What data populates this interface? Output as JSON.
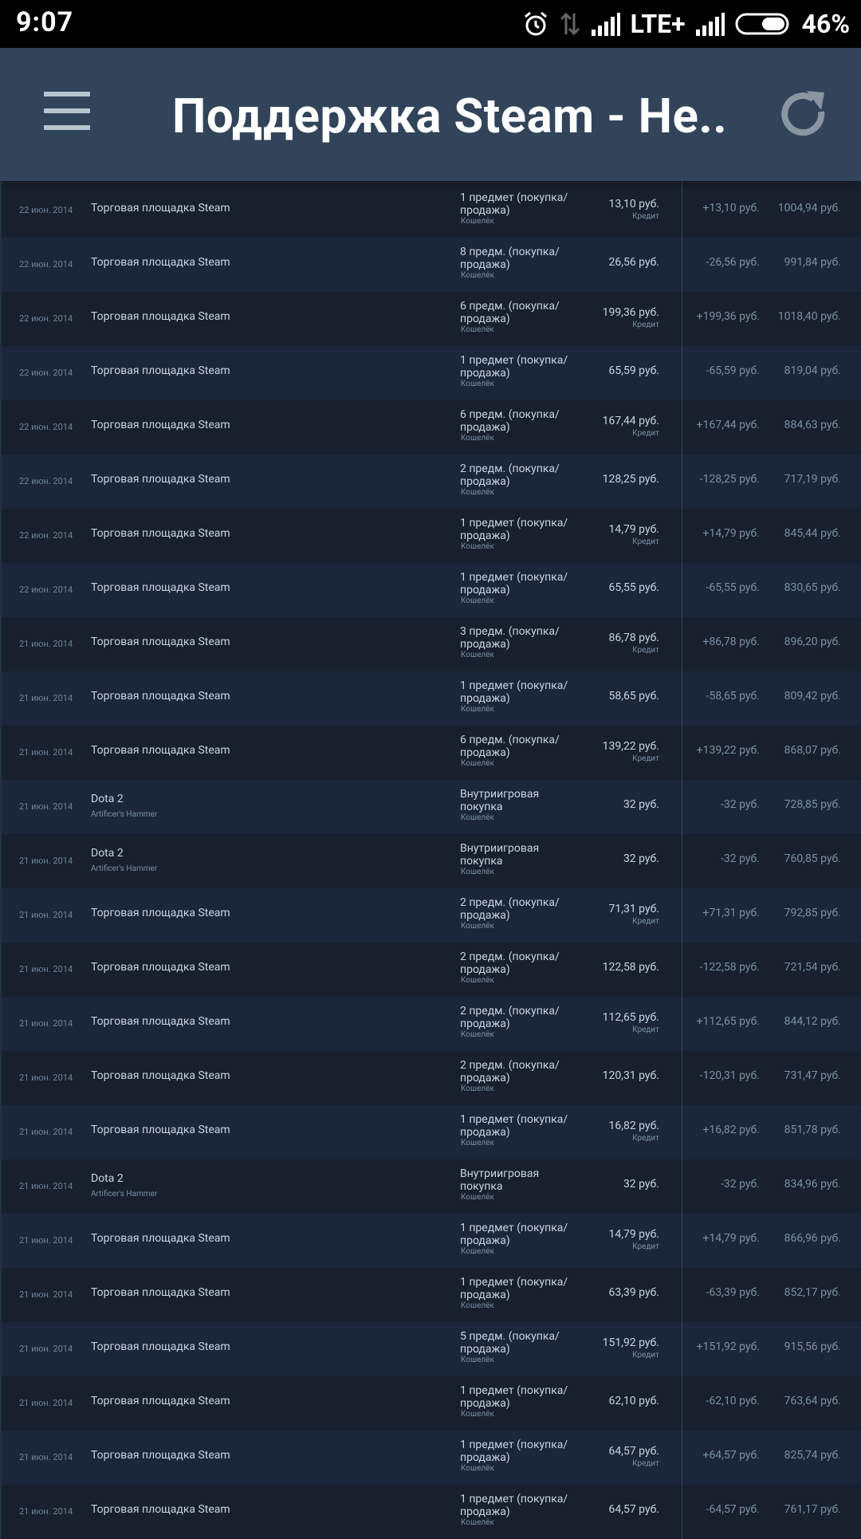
{
  "status_bar": {
    "time": "9:07",
    "network": "LTE+",
    "battery": "46%"
  },
  "app_bar": {
    "title": "Поддержка Steam - Не...",
    "menu_icon": "hamburger-menu-icon",
    "refresh_icon": "refresh-icon"
  },
  "colors": {
    "status_bg": "#000000",
    "app_bar_bg": "#32445a",
    "row_dark": "#17202c",
    "row_light": "#1b2738",
    "text_primary": "#c6d4df",
    "text_muted": "#7c8fa3"
  },
  "rows": [
    {
      "date": "",
      "name": "Торговая площадка Steam",
      "subtitle": "",
      "type": "1 предмет (покупка/ продажа)",
      "method": "Кошелёк",
      "amount": "",
      "credit": "",
      "change": "",
      "balance": ""
    },
    {
      "date": "22 июн. 2014",
      "name": "Торговая площадка Steam",
      "subtitle": "",
      "type": "1 предмет (покупка/ продажа)",
      "method": "Кошелёк",
      "amount": "13,10 руб.",
      "credit": "Кредит",
      "change": "+13,10 руб.",
      "balance": "1004,94 руб."
    },
    {
      "date": "22 июн. 2014",
      "name": "Торговая площадка Steam",
      "subtitle": "",
      "type": "8 предм. (покупка/ продажа)",
      "method": "Кошелёк",
      "amount": "26,56 руб.",
      "credit": "",
      "change": "-26,56 руб.",
      "balance": "991,84 руб."
    },
    {
      "date": "22 июн. 2014",
      "name": "Торговая площадка Steam",
      "subtitle": "",
      "type": "6 предм. (покупка/ продажа)",
      "method": "Кошелёк",
      "amount": "199,36 руб.",
      "credit": "Кредит",
      "change": "+199,36 руб.",
      "balance": "1018,40 руб."
    },
    {
      "date": "22 июн. 2014",
      "name": "Торговая площадка Steam",
      "subtitle": "",
      "type": "1 предмет (покупка/ продажа)",
      "method": "Кошелёк",
      "amount": "65,59 руб.",
      "credit": "",
      "change": "-65,59 руб.",
      "balance": "819,04 руб."
    },
    {
      "date": "22 июн. 2014",
      "name": "Торговая площадка Steam",
      "subtitle": "",
      "type": "6 предм. (покупка/ продажа)",
      "method": "Кошелёк",
      "amount": "167,44 руб.",
      "credit": "Кредит",
      "change": "+167,44 руб.",
      "balance": "884,63 руб."
    },
    {
      "date": "22 июн. 2014",
      "name": "Торговая площадка Steam",
      "subtitle": "",
      "type": "2 предм. (покупка/ продажа)",
      "method": "Кошелёк",
      "amount": "128,25 руб.",
      "credit": "",
      "change": "-128,25 руб.",
      "balance": "717,19 руб."
    },
    {
      "date": "22 июн. 2014",
      "name": "Торговая площадка Steam",
      "subtitle": "",
      "type": "1 предмет (покупка/ продажа)",
      "method": "Кошелёк",
      "amount": "14,79 руб.",
      "credit": "Кредит",
      "change": "+14,79 руб.",
      "balance": "845,44 руб."
    },
    {
      "date": "22 июн. 2014",
      "name": "Торговая площадка Steam",
      "subtitle": "",
      "type": "1 предмет (покупка/ продажа)",
      "method": "Кошелёк",
      "amount": "65,55 руб.",
      "credit": "",
      "change": "-65,55 руб.",
      "balance": "830,65 руб."
    },
    {
      "date": "21 июн. 2014",
      "name": "Торговая площадка Steam",
      "subtitle": "",
      "type": "3 предм. (покупка/ продажа)",
      "method": "Кошелёк",
      "amount": "86,78 руб.",
      "credit": "Кредит",
      "change": "+86,78 руб.",
      "balance": "896,20 руб."
    },
    {
      "date": "21 июн. 2014",
      "name": "Торговая площадка Steam",
      "subtitle": "",
      "type": "1 предмет (покупка/ продажа)",
      "method": "Кошелёк",
      "amount": "58,65 руб.",
      "credit": "",
      "change": "-58,65 руб.",
      "balance": "809,42 руб."
    },
    {
      "date": "21 июн. 2014",
      "name": "Торговая площадка Steam",
      "subtitle": "",
      "type": "6 предм. (покупка/ продажа)",
      "method": "Кошелёк",
      "amount": "139,22 руб.",
      "credit": "Кредит",
      "change": "+139,22 руб.",
      "balance": "868,07 руб."
    },
    {
      "date": "21 июн. 2014",
      "name": "Dota 2",
      "subtitle": "Artificer's Hammer",
      "type": "Внутриигровая покупка",
      "method": "Кошелёк",
      "amount": "32 руб.",
      "credit": "",
      "change": "-32 руб.",
      "balance": "728,85 руб."
    },
    {
      "date": "21 июн. 2014",
      "name": "Dota 2",
      "subtitle": "Artificer's Hammer",
      "type": "Внутриигровая покупка",
      "method": "Кошелёк",
      "amount": "32 руб.",
      "credit": "",
      "change": "-32 руб.",
      "balance": "760,85 руб."
    },
    {
      "date": "21 июн. 2014",
      "name": "Торговая площадка Steam",
      "subtitle": "",
      "type": "2 предм. (покупка/ продажа)",
      "method": "Кошелёк",
      "amount": "71,31 руб.",
      "credit": "Кредит",
      "change": "+71,31 руб.",
      "balance": "792,85 руб."
    },
    {
      "date": "21 июн. 2014",
      "name": "Торговая площадка Steam",
      "subtitle": "",
      "type": "2 предм. (покупка/ продажа)",
      "method": "Кошелёк",
      "amount": "122,58 руб.",
      "credit": "",
      "change": "-122,58 руб.",
      "balance": "721,54 руб."
    },
    {
      "date": "21 июн. 2014",
      "name": "Торговая площадка Steam",
      "subtitle": "",
      "type": "2 предм. (покупка/ продажа)",
      "method": "Кошелёк",
      "amount": "112,65 руб.",
      "credit": "Кредит",
      "change": "+112,65 руб.",
      "balance": "844,12 руб."
    },
    {
      "date": "21 июн. 2014",
      "name": "Торговая площадка Steam",
      "subtitle": "",
      "type": "2 предм. (покупка/ продажа)",
      "method": "Кошелёк",
      "amount": "120,31 руб.",
      "credit": "",
      "change": "-120,31 руб.",
      "balance": "731,47 руб."
    },
    {
      "date": "21 июн. 2014",
      "name": "Торговая площадка Steam",
      "subtitle": "",
      "type": "1 предмет (покупка/ продажа)",
      "method": "Кошелёк",
      "amount": "16,82 руб.",
      "credit": "Кредит",
      "change": "+16,82 руб.",
      "balance": "851,78 руб."
    },
    {
      "date": "21 июн. 2014",
      "name": "Dota 2",
      "subtitle": "Artificer's Hammer",
      "type": "Внутриигровая покупка",
      "method": "Кошелёк",
      "amount": "32 руб.",
      "credit": "",
      "change": "-32 руб.",
      "balance": "834,96 руб."
    },
    {
      "date": "21 июн. 2014",
      "name": "Торговая площадка Steam",
      "subtitle": "",
      "type": "1 предмет (покупка/ продажа)",
      "method": "Кошелёк",
      "amount": "14,79 руб.",
      "credit": "Кредит",
      "change": "+14,79 руб.",
      "balance": "866,96 руб."
    },
    {
      "date": "21 июн. 2014",
      "name": "Торговая площадка Steam",
      "subtitle": "",
      "type": "1 предмет (покупка/ продажа)",
      "method": "Кошелёк",
      "amount": "63,39 руб.",
      "credit": "",
      "change": "-63,39 руб.",
      "balance": "852,17 руб."
    },
    {
      "date": "21 июн. 2014",
      "name": "Торговая площадка Steam",
      "subtitle": "",
      "type": "5 предм. (покупка/ продажа)",
      "method": "Кошелёк",
      "amount": "151,92 руб.",
      "credit": "Кредит",
      "change": "+151,92 руб.",
      "balance": "915,56 руб."
    },
    {
      "date": "21 июн. 2014",
      "name": "Торговая площадка Steam",
      "subtitle": "",
      "type": "1 предмет (покупка/ продажа)",
      "method": "Кошелёк",
      "amount": "62,10 руб.",
      "credit": "",
      "change": "-62,10 руб.",
      "balance": "763,64 руб."
    },
    {
      "date": "21 июн. 2014",
      "name": "Торговая площадка Steam",
      "subtitle": "",
      "type": "1 предмет (покупка/ продажа)",
      "method": "Кошелёк",
      "amount": "64,57 руб.",
      "credit": "Кредит",
      "change": "+64,57 руб.",
      "balance": "825,74 руб."
    },
    {
      "date": "21 июн. 2014",
      "name": "Торговая площадка Steam",
      "subtitle": "",
      "type": "1 предмет (покупка/ продажа)",
      "method": "Кошелёк",
      "amount": "64,57 руб.",
      "credit": "",
      "change": "-64,57 руб.",
      "balance": "761,17 руб."
    }
  ]
}
